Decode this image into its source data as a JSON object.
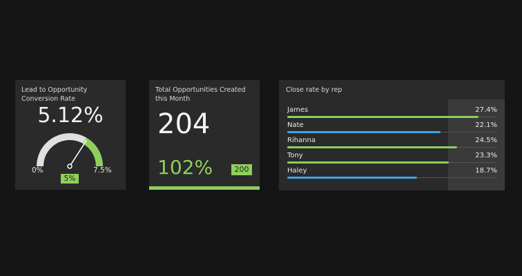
{
  "colors": {
    "accent_green": "#8fcf5b",
    "accent_blue": "#3da5e8",
    "card_bg": "#2a2a2a",
    "page_bg": "#151515"
  },
  "conversion": {
    "title": "Lead to Opportunity Conversion Rate",
    "value": "5.12%",
    "min_label": "0%",
    "max_label": "7.5%",
    "target_label": "5%",
    "gauge": {
      "min": 0,
      "max": 7.5,
      "value": 5.12,
      "target": 5
    }
  },
  "opportunities": {
    "title": "Total Opportunities Created this Month",
    "value": "204",
    "percent_of_target": "102%",
    "target": "200",
    "progress": 1.02
  },
  "close_rate": {
    "title": "Close rate by rep",
    "target_fraction": 0.8,
    "reps": [
      {
        "name": "James",
        "value": "27.4%",
        "fraction": 0.91,
        "color": "#8fcf5b"
      },
      {
        "name": "Nate",
        "value": "22.1%",
        "fraction": 0.73,
        "color": "#3da5e8"
      },
      {
        "name": "Rihanna",
        "value": "24.5%",
        "fraction": 0.81,
        "color": "#8fcf5b"
      },
      {
        "name": "Tony",
        "value": "23.3%",
        "fraction": 0.77,
        "color": "#8fcf5b"
      },
      {
        "name": "Haley",
        "value": "18.7%",
        "fraction": 0.62,
        "color": "#3da5e8"
      }
    ]
  }
}
